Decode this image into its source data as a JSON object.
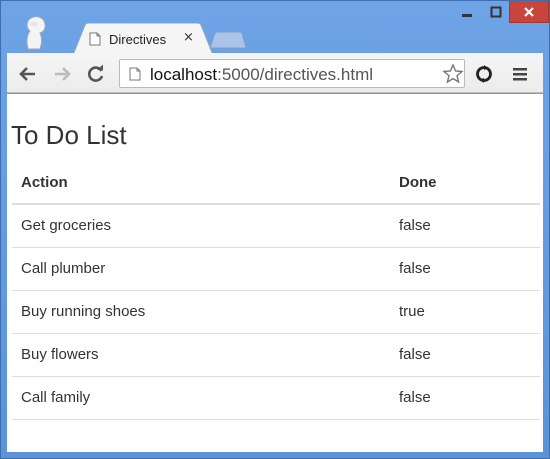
{
  "browser": {
    "tab": {
      "title": "Directives",
      "close_glyph": "×"
    },
    "address_bar": {
      "host": "localhost",
      "path": ":5000/directives.html"
    },
    "icons": {
      "profile": "profile-icon",
      "tab_favicon": "page-icon",
      "new_tab": "new-tab-icon",
      "back": "back-arrow-icon",
      "forward": "forward-arrow-icon",
      "reload": "reload-icon",
      "bookmark": "star-icon",
      "extension": "extension-icon",
      "menu": "menu-icon",
      "minimize": "minimize-icon",
      "maximize": "maximize-icon",
      "close": "close-icon"
    }
  },
  "page": {
    "title": "To Do List",
    "table": {
      "headers": [
        "Action",
        "Done"
      ],
      "rows": [
        [
          "Get groceries",
          "false"
        ],
        [
          "Call plumber",
          "false"
        ],
        [
          "Buy running shoes",
          "true"
        ],
        [
          "Buy flowers",
          "false"
        ],
        [
          "Call family",
          "false"
        ]
      ]
    }
  },
  "colors": {
    "titlebar": "#6ea4e6",
    "close_button": "#c7453b",
    "table_border": "#dddddd",
    "text": "#333333"
  }
}
